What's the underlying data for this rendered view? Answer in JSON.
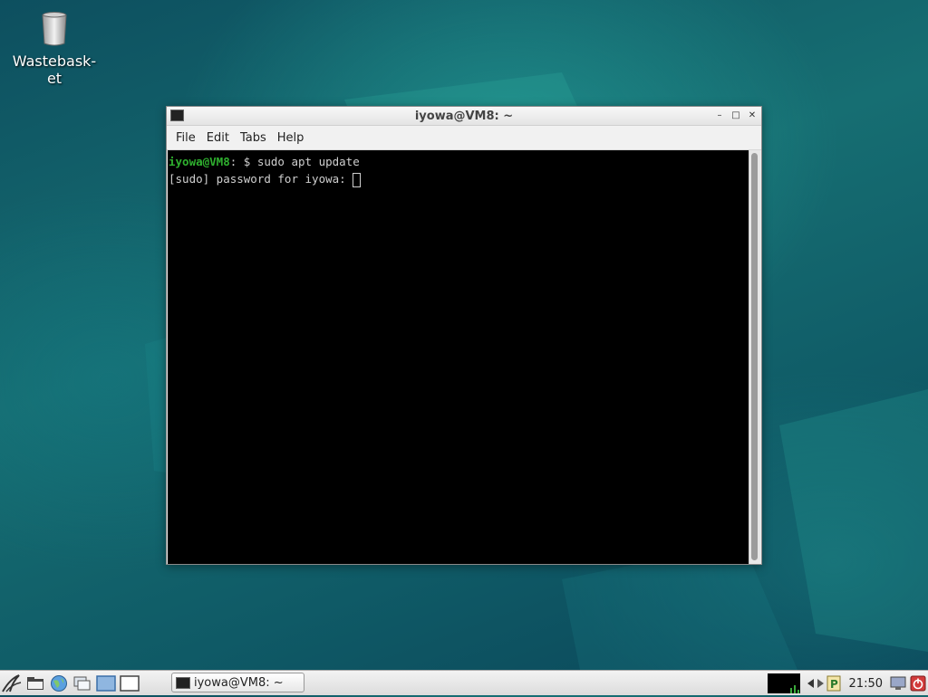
{
  "desktop": {
    "icons": [
      {
        "label": "Wastebask-\net",
        "icon": "trash-icon"
      }
    ]
  },
  "window": {
    "title": "iyowa@VM8: ~",
    "controls": {
      "minimize": "–",
      "maximize": "□",
      "close": "✕"
    },
    "menu": [
      "File",
      "Edit",
      "Tabs",
      "Help"
    ],
    "terminal": {
      "prompt_user": "iyowa@VM8",
      "prompt_rest": ": $ ",
      "command": "sudo apt update",
      "line2": "[sudo] password for iyowa: "
    }
  },
  "taskbar": {
    "launchers": [
      "start-menu-icon",
      "file-manager-icon",
      "web-browser-icon",
      "windows-icon",
      "desktop1-icon",
      "desktop2-icon"
    ],
    "task_title": "iyowa@VM8: ~",
    "clock": "21:50",
    "tray_icons": [
      "cpu-monitor-icon",
      "network-icon",
      "clipboard-icon",
      "screen-icon",
      "power-icon"
    ]
  },
  "colors": {
    "prompt_green": "#2fb12f",
    "terminal_bg": "#000000",
    "desktop_teal": "#166e72"
  }
}
